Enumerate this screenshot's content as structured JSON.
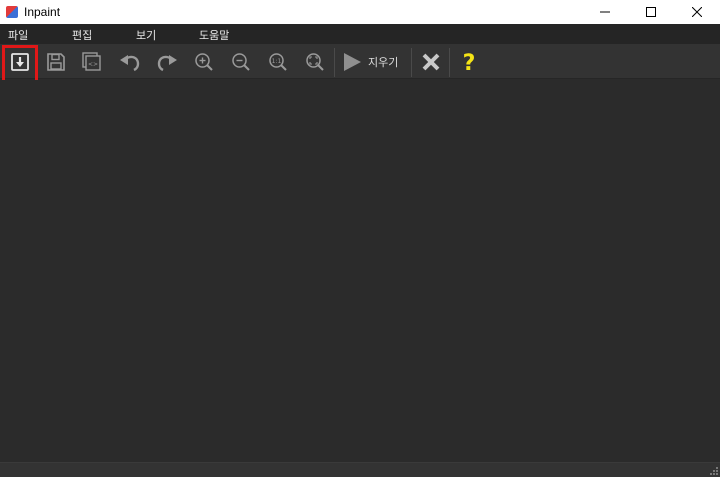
{
  "window": {
    "title": "Inpaint"
  },
  "menu": {
    "items": [
      "파일",
      "편집",
      "보기",
      "도움말"
    ]
  },
  "toolbar": {
    "erase_label": "지우기",
    "zoom_actual_label": "1:1"
  },
  "colors": {
    "highlight": "#e01818",
    "help_icon": "#f5e416",
    "background": "#2b2b2b"
  }
}
